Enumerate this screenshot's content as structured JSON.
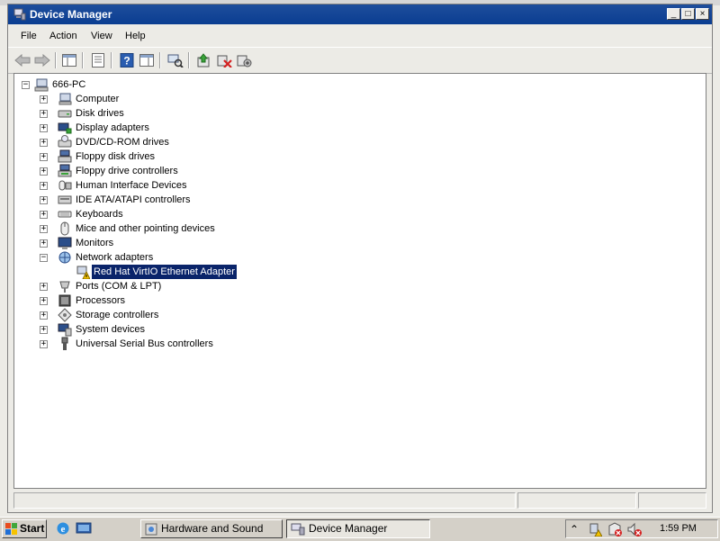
{
  "window": {
    "title": "Device Manager",
    "controls": {
      "minimize": "_",
      "maximize": "□",
      "close": "×"
    }
  },
  "menubar": {
    "items": [
      "File",
      "Action",
      "View",
      "Help"
    ]
  },
  "toolbar": {
    "buttons": [
      {
        "icon": "back-arrow-icon"
      },
      {
        "icon": "forward-arrow-icon"
      },
      {
        "icon": "show-hide-console-tree-icon"
      },
      {
        "icon": "properties-icon"
      },
      {
        "icon": "help-icon"
      },
      {
        "icon": "show-hide-action-pane-icon"
      },
      {
        "icon": "scan-hardware-changes-icon"
      },
      {
        "icon": "update-driver-icon"
      },
      {
        "icon": "uninstall-icon"
      },
      {
        "icon": "enable-device-icon"
      }
    ]
  },
  "tree": {
    "root": {
      "label": "666-PC",
      "expanded": true
    },
    "categories": [
      {
        "label": "Computer",
        "icon": "computer-icon"
      },
      {
        "label": "Disk drives",
        "icon": "disk-drive-icon"
      },
      {
        "label": "Display adapters",
        "icon": "display-adapter-icon"
      },
      {
        "label": "DVD/CD-ROM drives",
        "icon": "dvd-drive-icon"
      },
      {
        "label": "Floppy disk drives",
        "icon": "floppy-icon"
      },
      {
        "label": "Floppy drive controllers",
        "icon": "floppy-controller-icon"
      },
      {
        "label": "Human Interface Devices",
        "icon": "hid-icon"
      },
      {
        "label": "IDE ATA/ATAPI controllers",
        "icon": "ide-controller-icon"
      },
      {
        "label": "Keyboards",
        "icon": "keyboard-icon"
      },
      {
        "label": "Mice and other pointing devices",
        "icon": "mouse-icon"
      },
      {
        "label": "Monitors",
        "icon": "monitor-icon"
      },
      {
        "label": "Network adapters",
        "icon": "network-adapter-icon",
        "expanded": true,
        "children": [
          {
            "label": "Red Hat VirtIO Ethernet Adapter",
            "icon": "warning-network-icon",
            "selected": true
          }
        ]
      },
      {
        "label": "Ports (COM & LPT)",
        "icon": "port-icon"
      },
      {
        "label": "Processors",
        "icon": "processor-icon"
      },
      {
        "label": "Storage controllers",
        "icon": "storage-controller-icon"
      },
      {
        "label": "System devices",
        "icon": "system-device-icon"
      },
      {
        "label": "Universal Serial Bus controllers",
        "icon": "usb-icon"
      }
    ]
  },
  "taskbar": {
    "start_label": "Start",
    "quick_launch": [
      {
        "icon": "internet-explorer-icon"
      },
      {
        "icon": "server-manager-icon"
      }
    ],
    "tasks": [
      {
        "label": "Hardware and Sound",
        "active": false
      },
      {
        "label": "Device Manager",
        "active": true
      }
    ],
    "tray": {
      "time": "1:59 PM",
      "icons": [
        "show-hidden-icons",
        "network-warning-icon",
        "action-center-icon",
        "volume-muted-icon"
      ]
    }
  },
  "colors": {
    "titlebar": "#0a3d91",
    "selection": "#0a246a",
    "warning": "#f2c200"
  }
}
